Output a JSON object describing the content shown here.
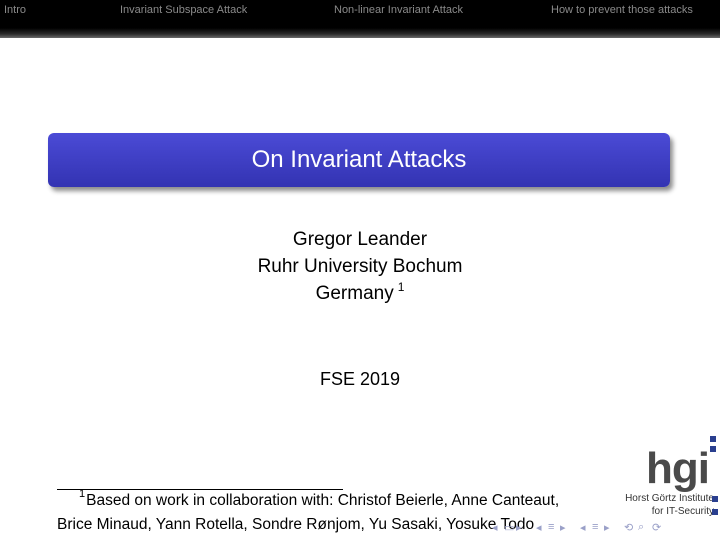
{
  "header": {
    "sections": [
      "Intro",
      "Invariant Subspace Attack",
      "Non-linear Invariant Attack",
      "How to prevent those attacks"
    ]
  },
  "title": "On Invariant Attacks",
  "author": {
    "name": "Gregor Leander",
    "institution": "Ruhr University Bochum",
    "country": "Germany",
    "footnote_mark": "1"
  },
  "conference": "FSE 2019",
  "footnote": {
    "mark": "1",
    "line1": "Based on work in collaboration with: Christof Beierle, Anne Canteaut,",
    "line2": "Brice Minaud, Yann Rotella, Sondre Rønjom, Yu Sasaki, Yosuke Todo"
  },
  "logo": {
    "letters": "hgi",
    "line1": "Horst Görtz Institute",
    "line2": "for IT-Security"
  },
  "colors": {
    "title_box": "#3f3fc4",
    "header_bg": "#000000",
    "header_text": "#8a8a8a",
    "logo_accent": "#2a3f8f"
  }
}
